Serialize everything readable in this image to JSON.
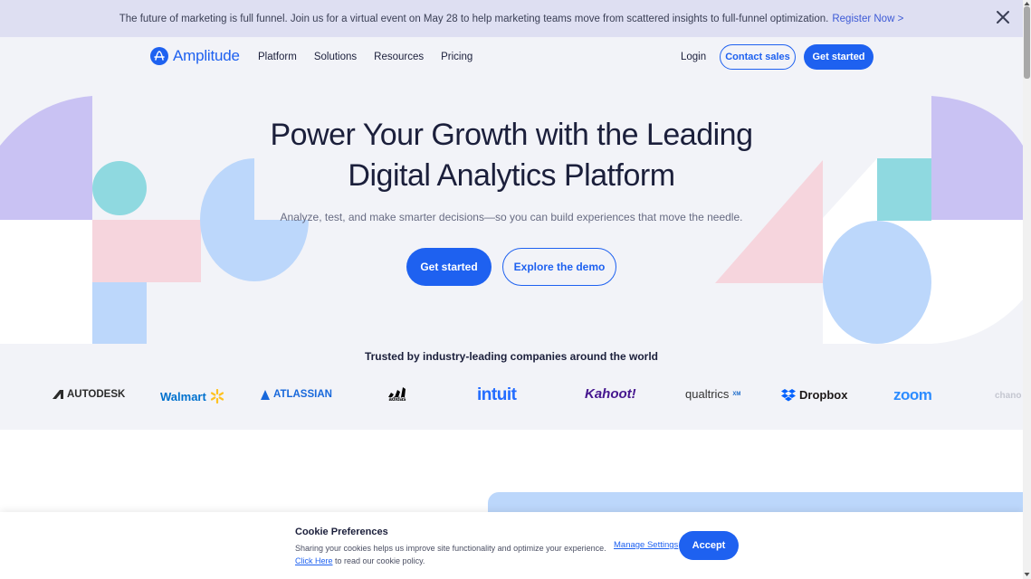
{
  "banner": {
    "text": "The future of marketing is full funnel. Join us for a virtual event on May 28 to help marketing teams move from scattered insights to full-funnel optimization.",
    "link": "Register Now >"
  },
  "nav": {
    "logo": "Amplitude",
    "links": [
      "Platform",
      "Solutions",
      "Resources",
      "Pricing"
    ],
    "login": "Login",
    "contact_sales": "Contact sales",
    "get_started": "Get started"
  },
  "hero": {
    "headline_line1": "Power Your Growth with the Leading",
    "headline_line2": "Digital Analytics Platform",
    "subheadline": "Analyze, test, and make smarter decisions—so you can build experiences that move the needle.",
    "primary_cta": "Get started",
    "secondary_cta": "Explore the demo"
  },
  "trust": {
    "heading": "Trusted by industry-leading companies around the world",
    "logos": [
      "AUTODESK",
      "Walmart",
      "ATLASSIAN",
      "adidas",
      "intuit",
      "Kahoot!",
      "qualtrics",
      "XM",
      "Dropbox",
      "zoom",
      "chano"
    ]
  },
  "cookie": {
    "title": "Cookie Preferences",
    "text1": "Sharing your cookies helps us improve site functionality and optimize your experience.",
    "link": "Click Here",
    "text2": " to read our cookie policy.",
    "manage": "Manage Settings",
    "accept": "Accept"
  },
  "colors": {
    "brand_blue": "#1e61f0",
    "banner_bg": "#dedff2",
    "hero_bg": "#f2f3f8",
    "lavender": "#c9c2f3",
    "teal": "#8fd9e0",
    "pink": "#f6d5dd",
    "sky": "#bcd7fb"
  }
}
